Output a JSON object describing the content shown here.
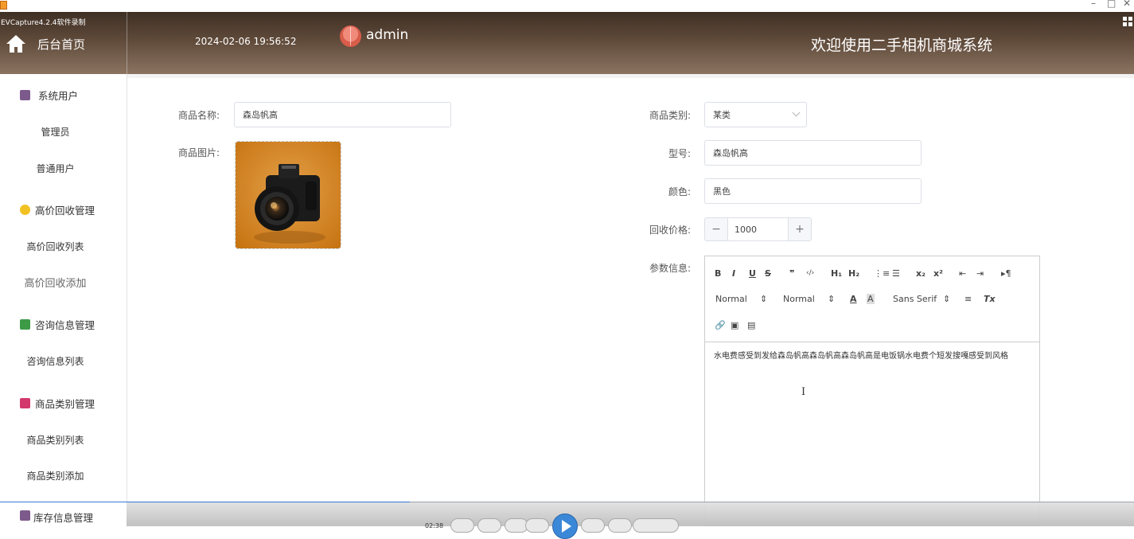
{
  "recorder": {
    "title": "EVCapture4.2.4软件录制",
    "time": "02:38",
    "controls": [
      "–",
      "□",
      "✕"
    ]
  },
  "header": {
    "home_label": "后台首页",
    "datetime": "2024-02-06 19:56:52",
    "user": "admin",
    "system_title": "欢迎使用二手相机商城系统"
  },
  "sidebar": {
    "groups": [
      {
        "label": "系统用户",
        "icon": "user-db-icon",
        "color": "#7d5a8c",
        "items": [
          "管理员",
          "普通用户"
        ]
      },
      {
        "label": "高价回收管理",
        "icon": "cube-icon",
        "color": "#f2c224",
        "items": [
          "高价回收列表",
          "高价回收添加"
        ]
      },
      {
        "label": "咨询信息管理",
        "icon": "chat-icon",
        "color": "#3d9a47",
        "items": [
          "咨询信息列表"
        ]
      },
      {
        "label": "商品类别管理",
        "icon": "bag-icon",
        "color": "#d2386b",
        "items": [
          "商品类别列表",
          "商品类别添加"
        ]
      },
      {
        "label": "库存信息管理",
        "icon": "user-db-icon",
        "color": "#7d5a8c",
        "items": []
      }
    ]
  },
  "form": {
    "name_label": "商品名称:",
    "name_value": "森岛帆高",
    "image_label": "商品图片:",
    "category_label": "商品类别:",
    "category_value": "某类",
    "model_label": "型号:",
    "model_value": "森岛帆高",
    "color_label": "颜色:",
    "color_value": "黑色",
    "price_label": "回收价格:",
    "price_value": "1000",
    "price_minus": "−",
    "price_plus": "+",
    "params_label": "参数信息:"
  },
  "editor": {
    "row1": [
      "B",
      "I",
      "U",
      "S",
      "❞",
      "‹/›",
      "H₁",
      "H₂",
      "⋮≡",
      "☰",
      "x₂",
      "x²",
      "⇤",
      "⇥",
      "▸¶"
    ],
    "header_select": "Normal",
    "size_select": "Normal",
    "font_select": "Sans Serif",
    "content": "水电费感受到发给森岛帆高森岛帆高森岛帆高是电饭锅水电费个短发搜嘎感受到风格"
  }
}
